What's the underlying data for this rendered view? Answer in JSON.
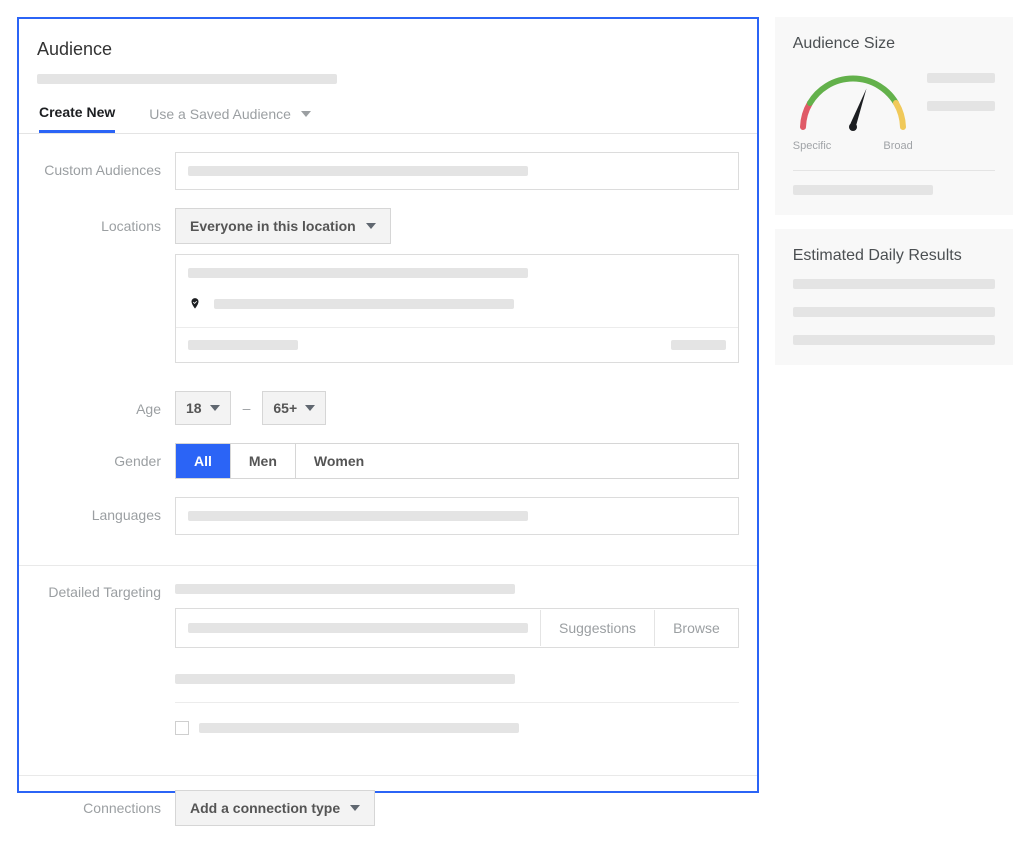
{
  "header": {
    "title": "Audience"
  },
  "tabs": {
    "create_new": "Create New",
    "use_saved": "Use a Saved Audience"
  },
  "labels": {
    "custom_audiences": "Custom Audiences",
    "locations": "Locations",
    "age": "Age",
    "gender": "Gender",
    "languages": "Languages",
    "detailed_targeting": "Detailed Targeting",
    "connections": "Connections"
  },
  "locations": {
    "scope": "Everyone in this location"
  },
  "age": {
    "min": "18",
    "max": "65+"
  },
  "gender": {
    "all": "All",
    "men": "Men",
    "women": "Women"
  },
  "detailed_targeting": {
    "suggestions": "Suggestions",
    "browse": "Browse"
  },
  "connections": {
    "select": "Add a connection type"
  },
  "audience_size": {
    "title": "Audience Size",
    "specific_label": "Specific",
    "broad_label": "Broad"
  },
  "estimated_results": {
    "title": "Estimated Daily Results"
  }
}
